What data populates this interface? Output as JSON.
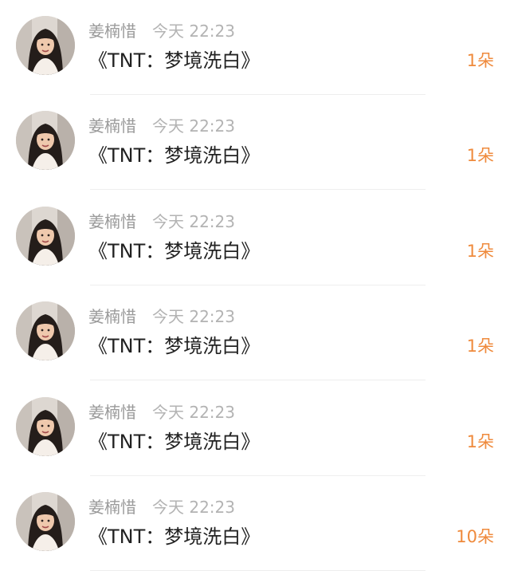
{
  "gift_list": [
    {
      "name": "姜楠惜",
      "time": "今天 22:23",
      "title": "《TNT：梦境洗白》",
      "amount": "1朵",
      "avatar_icon": "portrait-avatar"
    },
    {
      "name": "姜楠惜",
      "time": "今天 22:23",
      "title": "《TNT：梦境洗白》",
      "amount": "1朵",
      "avatar_icon": "portrait-avatar"
    },
    {
      "name": "姜楠惜",
      "time": "今天 22:23",
      "title": "《TNT：梦境洗白》",
      "amount": "1朵",
      "avatar_icon": "portrait-avatar"
    },
    {
      "name": "姜楠惜",
      "time": "今天 22:23",
      "title": "《TNT：梦境洗白》",
      "amount": "1朵",
      "avatar_icon": "portrait-avatar"
    },
    {
      "name": "姜楠惜",
      "time": "今天 22:23",
      "title": "《TNT：梦境洗白》",
      "amount": "1朵",
      "avatar_icon": "portrait-avatar"
    },
    {
      "name": "姜楠惜",
      "time": "今天 22:23",
      "title": "《TNT：梦境洗白》",
      "amount": "10朵",
      "avatar_icon": "portrait-avatar"
    }
  ],
  "colors": {
    "name": "#9a9a9a",
    "time": "#b3b3b3",
    "title": "#222222",
    "amount": "#ef8a3c",
    "divider": "#eeeeee"
  }
}
